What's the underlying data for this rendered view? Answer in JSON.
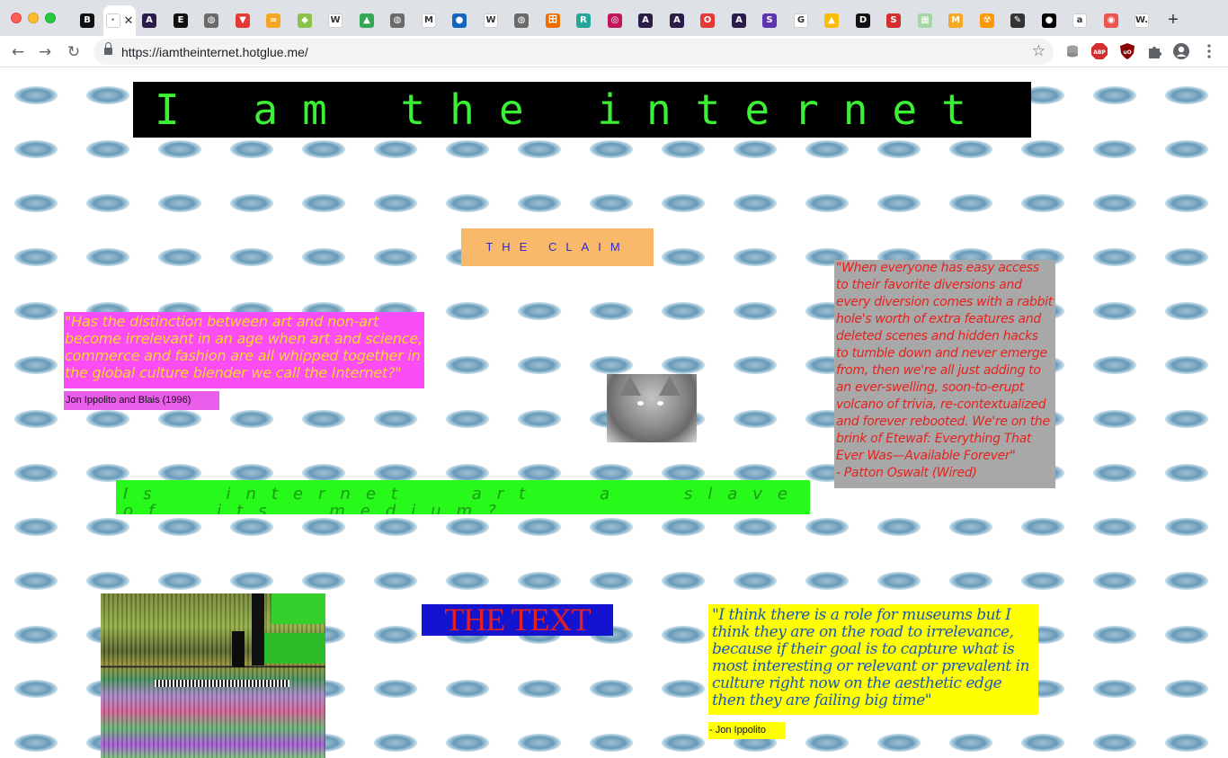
{
  "browser": {
    "url": "https://iamtheinternet.hotglue.me/",
    "tabs": [
      {
        "icon": "b-icon",
        "glyph": "B",
        "color": "#111111",
        "active": false
      },
      {
        "icon": "page-icon",
        "glyph": "·",
        "color": "#ffffff",
        "active": true
      },
      {
        "icon": "a-icon",
        "glyph": "A",
        "color": "#2b1d4a",
        "active": false
      },
      {
        "icon": "e-icon",
        "glyph": "E",
        "color": "#111111",
        "active": false
      },
      {
        "icon": "globe-icon",
        "glyph": "◍",
        "color": "#6a6a6a",
        "active": false
      },
      {
        "icon": "bookmark-icon",
        "glyph": "▼",
        "color": "#e53935",
        "active": false
      },
      {
        "icon": "link-icon",
        "glyph": "∞",
        "color": "#f5a623",
        "active": false
      },
      {
        "icon": "tag-icon",
        "glyph": "◆",
        "color": "#8bc34a",
        "active": false
      },
      {
        "icon": "wikipedia-icon",
        "glyph": "W",
        "color": "#ffffff",
        "active": false
      },
      {
        "icon": "drive-icon",
        "glyph": "▲",
        "color": "#34a853",
        "active": false
      },
      {
        "icon": "globe-icon",
        "glyph": "◍",
        "color": "#6a6a6a",
        "active": false
      },
      {
        "icon": "m-icon",
        "glyph": "M",
        "color": "#ffffff",
        "active": false
      },
      {
        "icon": "planet-icon",
        "glyph": "●",
        "color": "#1565c0",
        "active": false
      },
      {
        "icon": "wikipedia-icon",
        "glyph": "W",
        "color": "#ffffff",
        "active": false
      },
      {
        "icon": "globe-icon",
        "glyph": "◍",
        "color": "#6a6a6a",
        "active": false
      },
      {
        "icon": "grid-icon",
        "glyph": "田",
        "color": "#ef6c00",
        "active": false
      },
      {
        "icon": "r-icon",
        "glyph": "R",
        "color": "#26a69a",
        "active": false
      },
      {
        "icon": "instagram-icon",
        "glyph": "◎",
        "color": "#c2185b",
        "active": false
      },
      {
        "icon": "a-icon",
        "glyph": "A",
        "color": "#2b1d4a",
        "active": false
      },
      {
        "icon": "a-icon",
        "glyph": "A",
        "color": "#2b1d4a",
        "active": false
      },
      {
        "icon": "opera-icon",
        "glyph": "O",
        "color": "#e53935",
        "active": false
      },
      {
        "icon": "a-icon",
        "glyph": "A",
        "color": "#2b1d4a",
        "active": false
      },
      {
        "icon": "s-icon",
        "glyph": "S",
        "color": "#5e35b1",
        "active": false
      },
      {
        "icon": "google-icon",
        "glyph": "G",
        "color": "#ffffff",
        "active": false
      },
      {
        "icon": "drive-icon",
        "glyph": "▲",
        "color": "#fbbc04",
        "active": false
      },
      {
        "icon": "d-icon",
        "glyph": "D",
        "color": "#111111",
        "active": false
      },
      {
        "icon": "s-icon",
        "glyph": "S",
        "color": "#d32f2f",
        "active": false
      },
      {
        "icon": "sheet-icon",
        "glyph": "▦",
        "color": "#a5d6a7",
        "active": false
      },
      {
        "icon": "m-icon",
        "glyph": "M",
        "color": "#f9a825",
        "active": false
      },
      {
        "icon": "radiation-icon",
        "glyph": "☢",
        "color": "#ff9800",
        "active": false
      },
      {
        "icon": "pen-icon",
        "glyph": "✎",
        "color": "#333333",
        "active": false
      },
      {
        "icon": "sphere-icon",
        "glyph": "●",
        "color": "#000000",
        "active": false
      },
      {
        "icon": "amazon-icon",
        "glyph": "a",
        "color": "#ffffff",
        "active": false
      },
      {
        "icon": "target-icon",
        "glyph": "◉",
        "color": "#ef5350",
        "active": false
      },
      {
        "icon": "w-icon",
        "glyph": "W.",
        "color": "#ffffff",
        "active": false
      }
    ],
    "new_tab_label": "+"
  },
  "page": {
    "title": "I am the internet",
    "claim": "THE CLAIM",
    "quote1": "\"Has the distinction between art and non-art become irrelevant in an age when art and science, commerce and fashion are all whipped together in the global culture blender we call the Internet?\"",
    "quote1_attribution": "Jon Ippolito and Blais (1996)",
    "quote2": "\"When everyone has easy access to their favorite diversions and every diversion comes with a rabbit hole's worth of extra features and deleted scenes and hidden hacks to tumble down and never emerge from, then we're all just adding to an ever-swelling, soon-to-erupt volcano of trivia, re-contextualized and forever rebooted. We're on the brink of Etewaf: Everything That Ever Was—Available Forever\"",
    "quote2_attribution": "- Patton Oswalt (Wired)",
    "question": "Is internet art a slave of its medium?",
    "text_heading": "THE TEXT",
    "quote3": "\"I think there is a role for museums but I think they are on the road to irrelevance, because if their goal is to capture what is most interesting or relevant or prevalent in culture right now on the aesthetic edge then they are failing big time\"",
    "quote3_attribution": "- Jon Ippolito"
  },
  "colors": {
    "title_bg": "#000000",
    "title_text": "#3cf036",
    "claim_bg": "#f9b96b",
    "quote1_bg": "#fa4cf7",
    "quote2_bg": "#a8a8a8",
    "question_bg": "#27f91b",
    "text_heading_bg": "#1414d0",
    "quote3_bg": "#ffff00"
  }
}
